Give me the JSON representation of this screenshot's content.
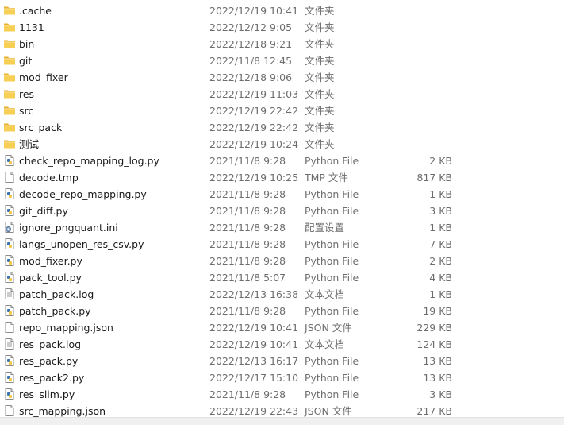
{
  "files": [
    {
      "name": ".cache",
      "date": "2022/12/19 10:41",
      "type": "文件夹",
      "size": "",
      "icon": "folder-icon"
    },
    {
      "name": "1131",
      "date": "2022/12/12 9:05",
      "type": "文件夹",
      "size": "",
      "icon": "folder-icon"
    },
    {
      "name": "bin",
      "date": "2022/12/18 9:21",
      "type": "文件夹",
      "size": "",
      "icon": "folder-icon"
    },
    {
      "name": "git",
      "date": "2022/11/8 12:45",
      "type": "文件夹",
      "size": "",
      "icon": "folder-icon"
    },
    {
      "name": "mod_fixer",
      "date": "2022/12/18 9:06",
      "type": "文件夹",
      "size": "",
      "icon": "folder-icon"
    },
    {
      "name": "res",
      "date": "2022/12/19 11:03",
      "type": "文件夹",
      "size": "",
      "icon": "folder-icon"
    },
    {
      "name": "src",
      "date": "2022/12/19 22:42",
      "type": "文件夹",
      "size": "",
      "icon": "folder-icon"
    },
    {
      "name": "src_pack",
      "date": "2022/12/19 22:42",
      "type": "文件夹",
      "size": "",
      "icon": "folder-icon"
    },
    {
      "name": "测试",
      "date": "2022/12/19 10:24",
      "type": "文件夹",
      "size": "",
      "icon": "folder-icon"
    },
    {
      "name": "check_repo_mapping_log.py",
      "date": "2021/11/8 9:28",
      "type": "Python File",
      "size": "2 KB",
      "icon": "python-file-icon"
    },
    {
      "name": "decode.tmp",
      "date": "2022/12/19 10:25",
      "type": "TMP 文件",
      "size": "817 KB",
      "icon": "blank-file-icon"
    },
    {
      "name": "decode_repo_mapping.py",
      "date": "2021/11/8 9:28",
      "type": "Python File",
      "size": "1 KB",
      "icon": "python-file-icon"
    },
    {
      "name": "git_diff.py",
      "date": "2021/11/8 9:28",
      "type": "Python File",
      "size": "3 KB",
      "icon": "python-file-icon"
    },
    {
      "name": "ignore_pngquant.ini",
      "date": "2021/11/8 9:28",
      "type": "配置设置",
      "size": "1 KB",
      "icon": "settings-file-icon"
    },
    {
      "name": "langs_unopen_res_csv.py",
      "date": "2021/11/8 9:28",
      "type": "Python File",
      "size": "7 KB",
      "icon": "python-file-icon"
    },
    {
      "name": "mod_fixer.py",
      "date": "2021/11/8 9:28",
      "type": "Python File",
      "size": "2 KB",
      "icon": "python-file-icon"
    },
    {
      "name": "pack_tool.py",
      "date": "2021/11/8 5:07",
      "type": "Python File",
      "size": "4 KB",
      "icon": "python-file-icon"
    },
    {
      "name": "patch_pack.log",
      "date": "2022/12/13 16:38",
      "type": "文本文档",
      "size": "1 KB",
      "icon": "text-file-icon"
    },
    {
      "name": "patch_pack.py",
      "date": "2021/11/8 9:28",
      "type": "Python File",
      "size": "19 KB",
      "icon": "python-file-icon"
    },
    {
      "name": "repo_mapping.json",
      "date": "2022/12/19 10:41",
      "type": "JSON 文件",
      "size": "229 KB",
      "icon": "blank-file-icon"
    },
    {
      "name": "res_pack.log",
      "date": "2022/12/19 10:41",
      "type": "文本文档",
      "size": "124 KB",
      "icon": "text-file-icon"
    },
    {
      "name": "res_pack.py",
      "date": "2022/12/13 16:17",
      "type": "Python File",
      "size": "13 KB",
      "icon": "python-file-icon"
    },
    {
      "name": "res_pack2.py",
      "date": "2022/12/17 15:10",
      "type": "Python File",
      "size": "13 KB",
      "icon": "python-file-icon"
    },
    {
      "name": "res_slim.py",
      "date": "2021/11/8 9:28",
      "type": "Python File",
      "size": "3 KB",
      "icon": "python-file-icon"
    },
    {
      "name": "src_mapping.json",
      "date": "2022/12/19 22:43",
      "type": "JSON 文件",
      "size": "217 KB",
      "icon": "blank-file-icon"
    }
  ],
  "colors": {
    "folder": "#f5c542",
    "python_blue": "#3a75b0",
    "python_yellow": "#f2c84b"
  }
}
